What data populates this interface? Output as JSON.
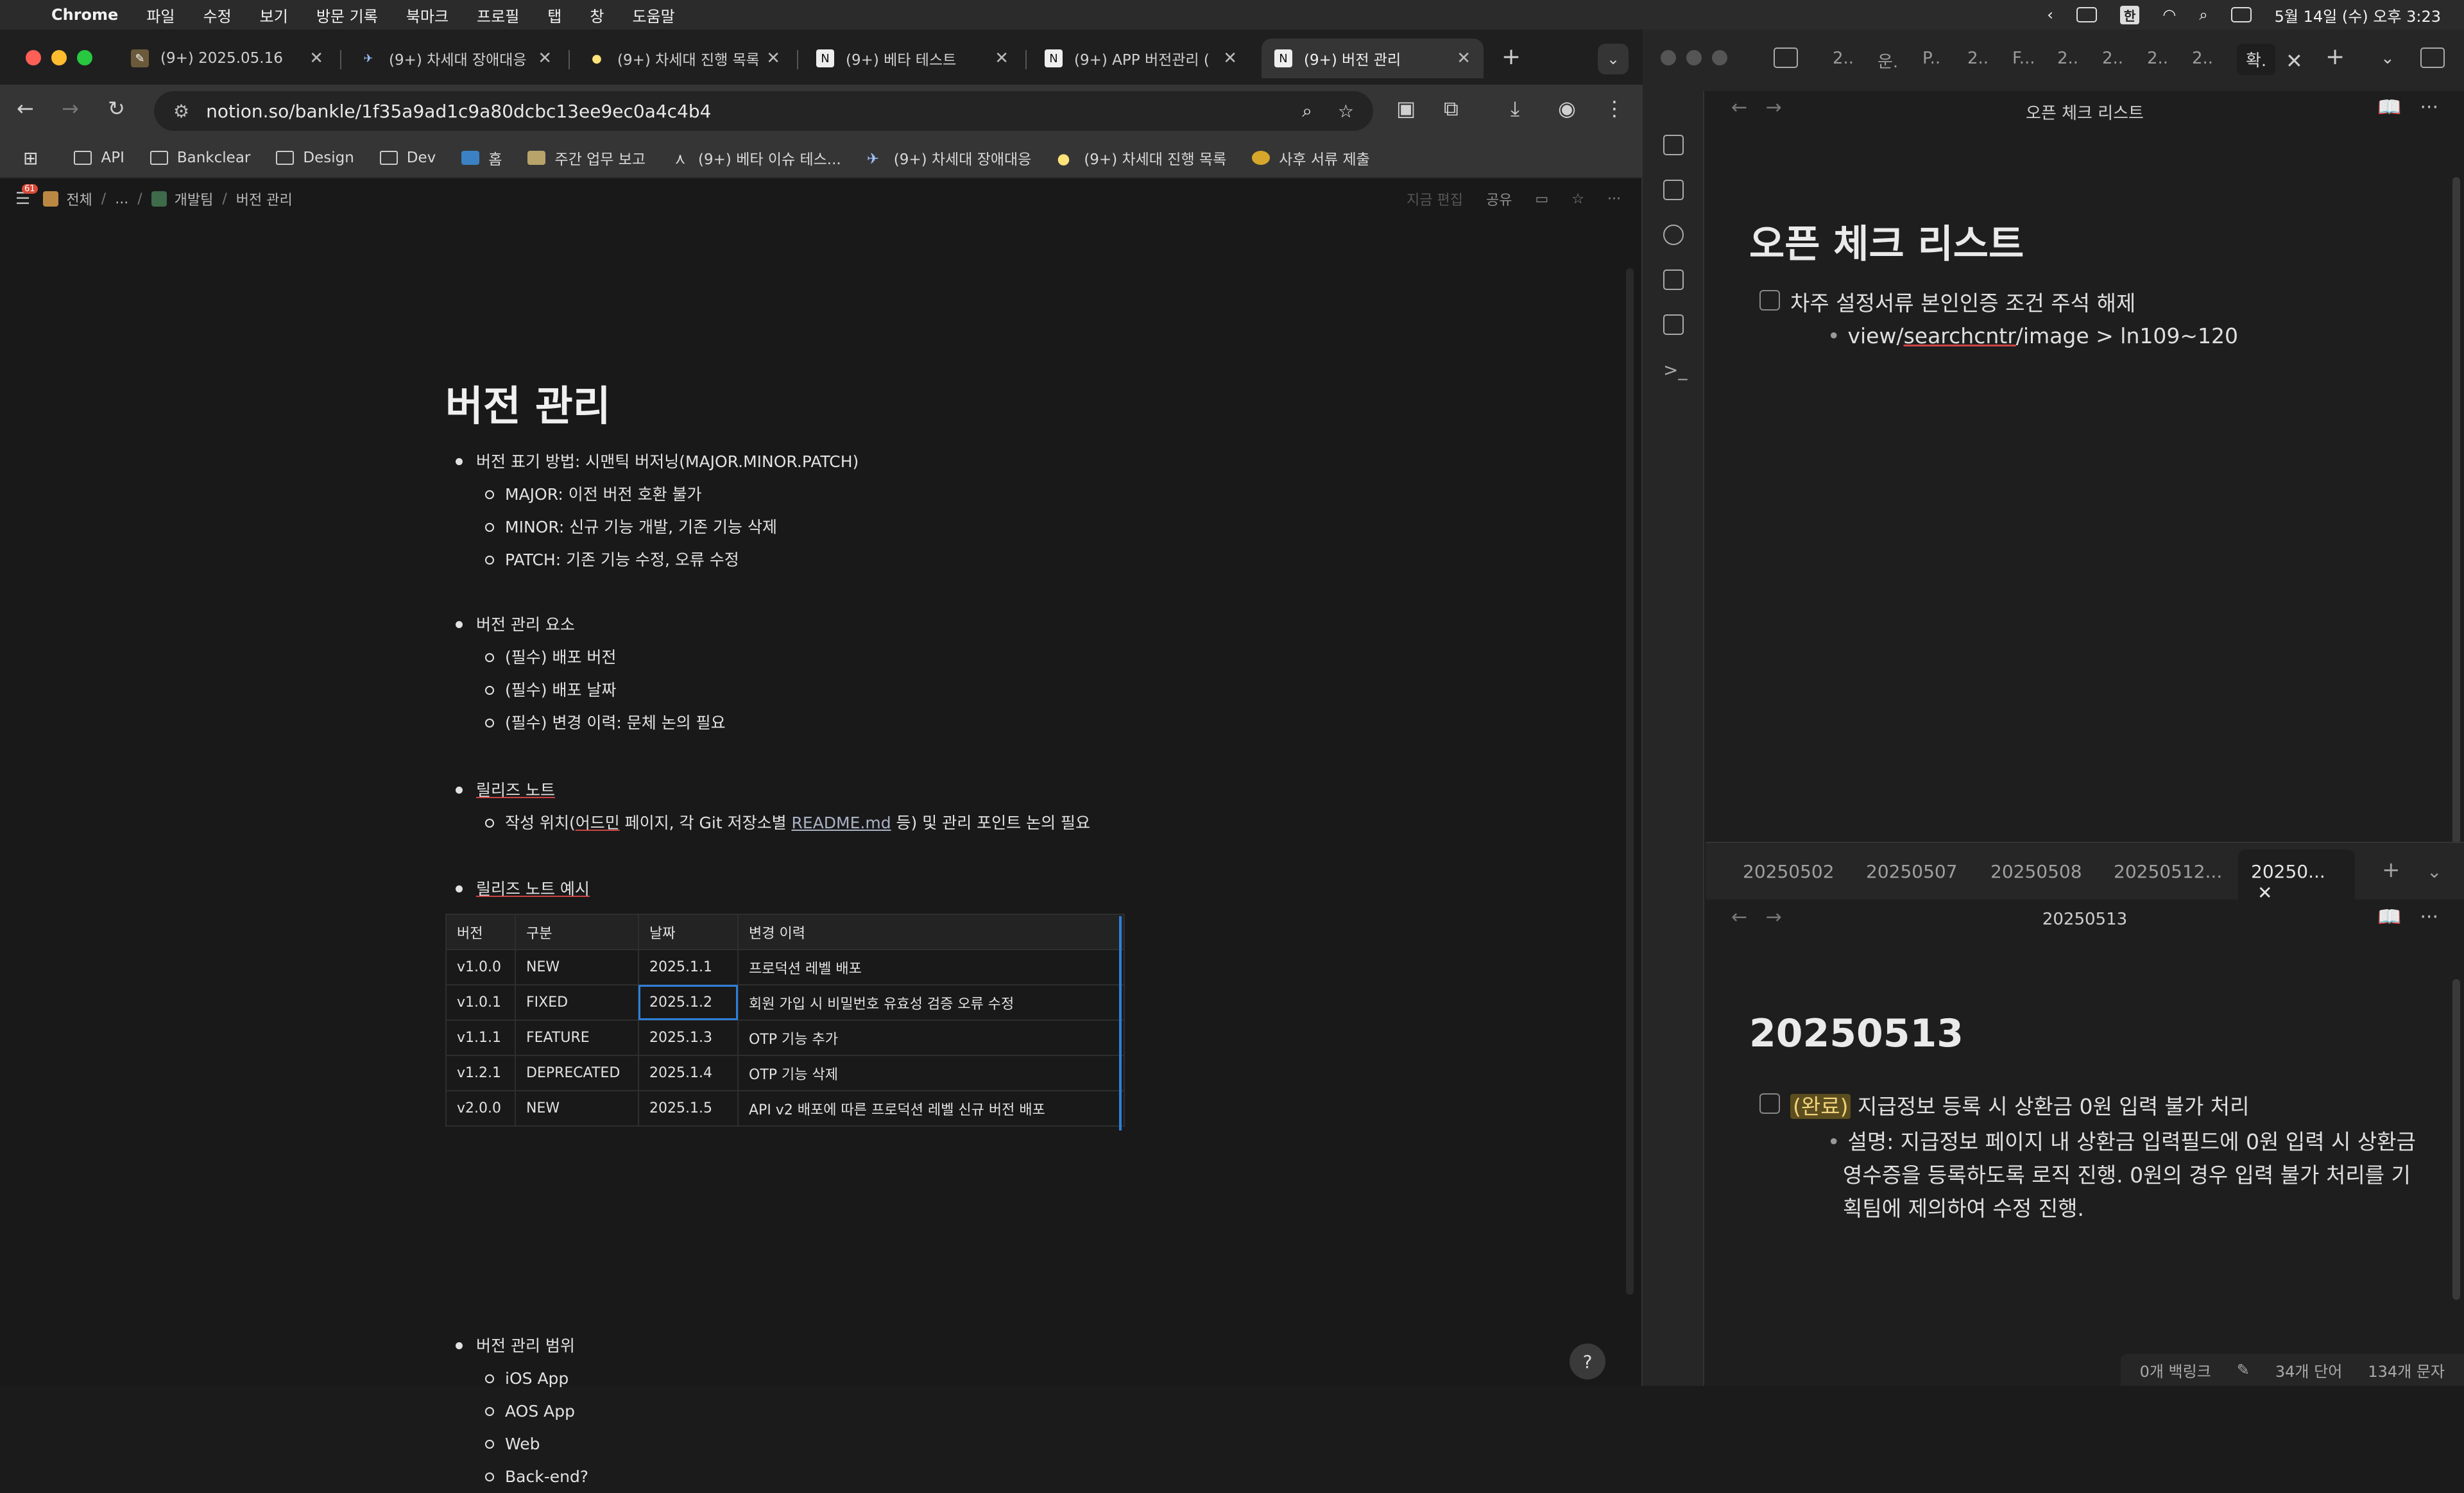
{
  "menubar": {
    "app": "Chrome",
    "items": [
      "파일",
      "수정",
      "보기",
      "방문 기록",
      "북마크",
      "프로필",
      "탭",
      "창",
      "도움말"
    ],
    "han": "한",
    "datetime": "5월 14일 (수) 오후 3:23"
  },
  "chrome": {
    "tabs": [
      {
        "label": "(9+) 2025.05.16",
        "icon": "📝"
      },
      {
        "label": "(9+) 차세대 장애대응",
        "icon": "✈"
      },
      {
        "label": "(9+) 차세대 진행 목록",
        "icon": "💡"
      },
      {
        "label": "(9+) 베타 테스트",
        "icon": "N"
      },
      {
        "label": "(9+) APP 버전관리 (",
        "icon": "N"
      },
      {
        "label": "(9+) 버전 관리",
        "icon": "N"
      }
    ],
    "url": "notion.so/bankle/1f35a9ad1c9a80dcbc13ee9ec0a4c4b4",
    "bookmarks": [
      "API",
      "Bankclear",
      "Design",
      "Dev",
      "홈",
      "주간 업무 보고",
      "(9+) 베타 이슈 테스...",
      "(9+) 차세대 장애대응",
      "(9+) 차세대 진행 목록",
      "사후 서류 제출"
    ]
  },
  "notion": {
    "badge": "61",
    "breadcrumb": [
      "전체",
      "...",
      "개발팀",
      "버전 관리"
    ],
    "top_actions": {
      "edited": "지금 편집",
      "share": "공유"
    },
    "title": "버전 관리",
    "sections": [
      {
        "text": "버전 표기 방법: 시맨틱 버저닝(MAJOR.MINOR.PATCH)",
        "children": [
          "MAJOR: 이전 버전 호환 불가",
          "MINOR: 신규 기능 개발, 기존 기능 삭제",
          "PATCH: 기존 기능 수정, 오류 수정"
        ]
      },
      {
        "text": "버전 관리 요소",
        "children": [
          "(필수) 배포 버전",
          "(필수) 배포 날짜",
          "(필수) 변경 이력: 문체 논의 필요"
        ]
      }
    ],
    "release_note": {
      "text": "릴리즈 노트",
      "child_pre": "작성 위치(",
      "child_underlined": "어드민",
      "child_mid": " 페이지, 각 Git 저장소별 ",
      "child_link": "README.md",
      "child_post": " 등) 및 관리 포인트 논의 필요"
    },
    "example_label": "릴리즈 노트 예시",
    "table": {
      "headers": [
        "버전",
        "구분",
        "날짜",
        "변경 이력"
      ],
      "rows": [
        [
          "v1.0.0",
          "NEW",
          "2025.1.1",
          "프로덕션 레벨 배포"
        ],
        [
          "v1.0.1",
          "FIXED",
          "2025.1.2",
          "회원 가입 시 비밀번호 유효성 검증 오류 수정"
        ],
        [
          "v1.1.1",
          "FEATURE",
          "2025.1.3",
          "OTP 기능 추가"
        ],
        [
          "v1.2.1",
          "DEPRECATED",
          "2025.1.4",
          "OTP 기능 삭제"
        ],
        [
          "v2.0.0",
          "NEW",
          "2025.1.5",
          "API v2 배포에 따른 프로덕션 레벨 신규 버전 배포"
        ]
      ]
    },
    "scope": {
      "text": "버전 관리 범위",
      "children": [
        "iOS App",
        "AOS App",
        "Web",
        "Back-end?"
      ]
    }
  },
  "obsidian": {
    "top_tabs": [
      "2..",
      "운.",
      "P..",
      "2..",
      "F...",
      "2..",
      "2..",
      "2..",
      "2..",
      "확."
    ],
    "pane1": {
      "title": "오픈 체크 리스트",
      "heading": "오픈 체크 리스트",
      "task": "차주 설정서류 본인인증 조건 주석 해제",
      "sub_pre": "view/",
      "sub_underlined": "searchcntr",
      "sub_post": "/image > ln109~120"
    },
    "pane2_tabs": [
      "20250502",
      "20250507",
      "20250508",
      "20250512...",
      "20250..."
    ],
    "pane2": {
      "title": "20250513",
      "heading": "20250513",
      "task_tag": "(완료)",
      "task": " 지급정보 등록 시 상환금 0원 입력 불가 처리",
      "desc_lines": [
        "설명: 지급정보 페이지 내 상환금 입력필드에 0원 입력 시 상환금",
        "영수증을 등록하도록 로직 진행. 0원의 경우 입력 불가 처리를 기",
        "획팀에 제의하여 수정 진행."
      ]
    },
    "status": {
      "backlinks": "0개 백링크",
      "words": "34개 단어",
      "chars": "134개 문자"
    }
  }
}
